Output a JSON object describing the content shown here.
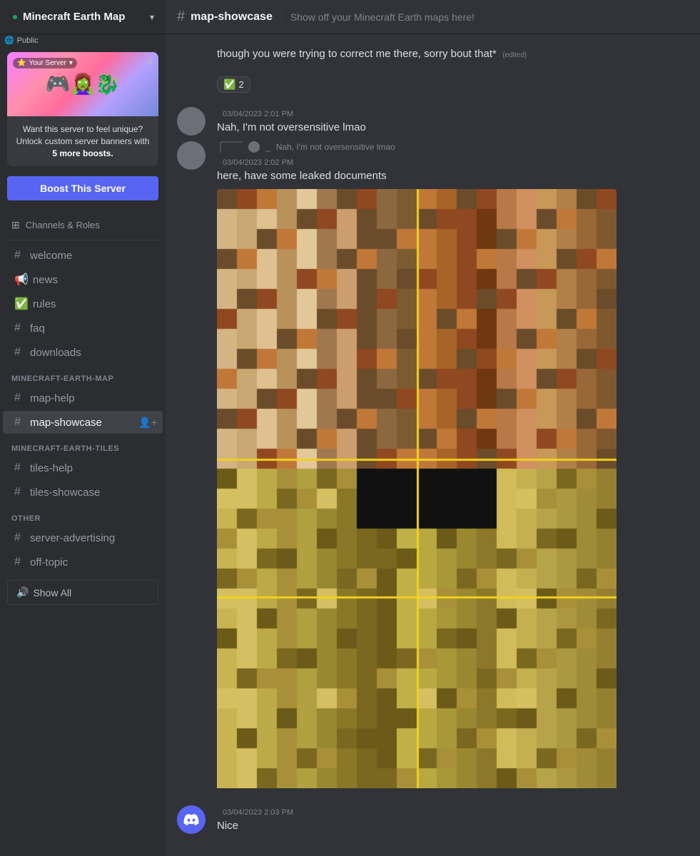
{
  "server": {
    "name": "Minecraft Earth Map",
    "public_label": "Public",
    "status_color": "#23a559"
  },
  "promo": {
    "banner_label": "Your Server",
    "description": "Want this server to feel unique? Unlock custom server banners with",
    "boost_highlight": "5 more boosts.",
    "boost_button": "Boost This Server"
  },
  "sidebar": {
    "channels_roles_label": "Channels & Roles",
    "divider": true,
    "channels": [
      {
        "name": "welcome",
        "icon": "#",
        "type": "text"
      },
      {
        "name": "news",
        "icon": "📢",
        "type": "announce"
      },
      {
        "name": "rules",
        "icon": "✅",
        "type": "rules"
      },
      {
        "name": "faq",
        "icon": "#",
        "type": "text"
      },
      {
        "name": "downloads",
        "icon": "#",
        "type": "text"
      }
    ],
    "categories": [
      {
        "name": "MINECRAFT-EARTH-MAP",
        "channels": [
          {
            "name": "map-help",
            "icon": "#",
            "type": "text",
            "active": false
          },
          {
            "name": "map-showcase",
            "icon": "#",
            "type": "text",
            "active": true
          }
        ]
      },
      {
        "name": "MINECRAFT-EARTH-TILES",
        "channels": [
          {
            "name": "tiles-help",
            "icon": "#",
            "type": "text",
            "active": false
          },
          {
            "name": "tiles-showcase",
            "icon": "#",
            "type": "text",
            "active": false
          }
        ]
      },
      {
        "name": "OTHER",
        "channels": [
          {
            "name": "server-advertising",
            "icon": "#",
            "type": "text",
            "active": false
          },
          {
            "name": "off-topic",
            "icon": "#",
            "type": "text",
            "active": false
          }
        ]
      }
    ],
    "show_all_label": "Show All"
  },
  "channel_header": {
    "icon": "#",
    "name": "map-showcase",
    "topic": "Show off your Minecraft Earth maps here!"
  },
  "messages": [
    {
      "id": "msg1",
      "type": "continuation",
      "text": "though you were trying to correct me there, sorry bout that*",
      "edited": "(edited)",
      "reaction": {
        "emoji": "✅",
        "count": "2"
      }
    },
    {
      "id": "msg2",
      "type": "full",
      "avatar_color": "#6d6f78",
      "timestamp": "03/04/2023 2:01 PM",
      "text": "Nah, I'm not oversensitive lmao"
    },
    {
      "id": "msg3",
      "type": "full",
      "avatar_color": "#6d6f78",
      "has_quote": true,
      "quote_author": "_",
      "quote_text": "Nah, I'm not oversensitive lmao",
      "timestamp": "03/04/2023 2:02 PM",
      "text": "here, have some leaked documents",
      "has_image": true
    },
    {
      "id": "msg4",
      "type": "full",
      "avatar_color": "#5865f2",
      "avatar_icon": "discord",
      "timestamp": "03/04/2023 2:03 PM",
      "text": "Nice"
    }
  ]
}
